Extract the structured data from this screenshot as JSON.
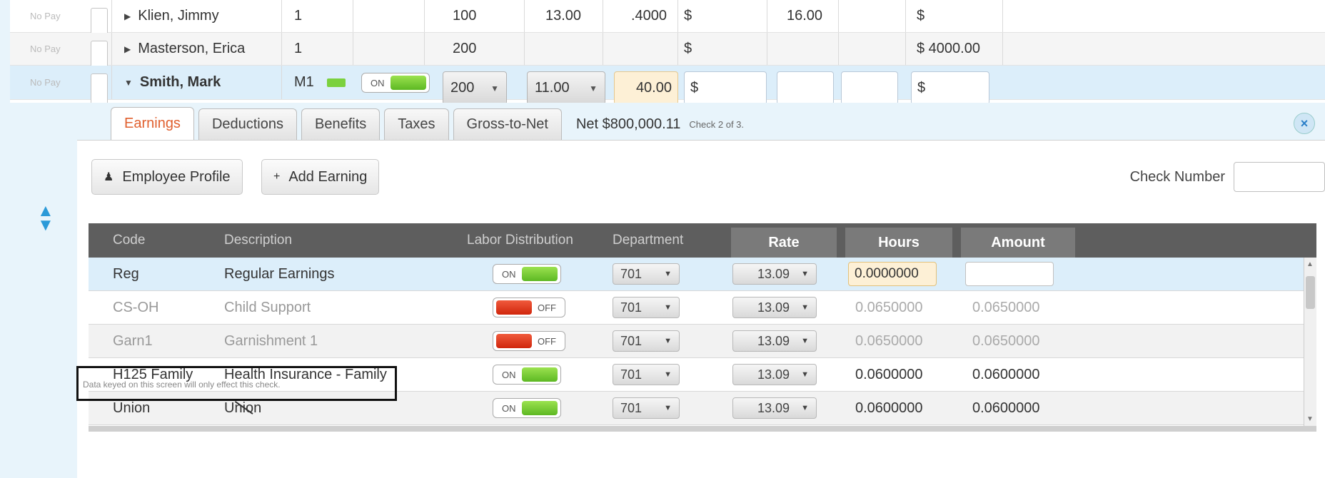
{
  "payroll_rows": [
    {
      "status": "No Pay",
      "name": "Klien, Jimmy",
      "code": "1",
      "col4": "100",
      "rate": "13.00",
      "hours": ".4000",
      "amount_prefix": "$",
      "col8": "16.00",
      "total": "$"
    },
    {
      "status": "No Pay",
      "name": "Masterson, Erica",
      "code": "1",
      "col4": "200",
      "rate": "",
      "hours": "",
      "amount_prefix": "$",
      "col8": "",
      "total": "$ 4000.00"
    },
    {
      "status": "No Pay",
      "name": "Smith, Mark",
      "code": "M1",
      "toggle": "ON",
      "col4": "200",
      "rate": "11.00",
      "hours": "40.00",
      "amount_prefix": "$",
      "total": "$"
    }
  ],
  "tabs": [
    {
      "label": "Earnings",
      "active": true
    },
    {
      "label": "Deductions"
    },
    {
      "label": "Benefits"
    },
    {
      "label": "Taxes"
    },
    {
      "label": "Gross-to-Net"
    }
  ],
  "net_label": "Net $800,000.11",
  "check_of": "Check 2 of 3.",
  "close_icon": "×",
  "buttons": {
    "employee_profile": "Employee Profile",
    "add_earning": "Add Earning"
  },
  "check_number_label": "Check Number",
  "columns": {
    "code": "Code",
    "description": "Description",
    "labor_distribution": "Labor Distribution",
    "department": "Department",
    "rate": "Rate",
    "hours": "Hours",
    "amount": "Amount"
  },
  "earnings": [
    {
      "code": "Reg",
      "description": "Regular Earnings",
      "labor": "ON",
      "department": "701",
      "rate": "13.09",
      "hours": "0.0000000",
      "amount": "",
      "dim": false
    },
    {
      "code": "CS-OH",
      "description": "Child Support",
      "labor": "OFF",
      "department": "701",
      "rate": "13.09",
      "hours": "0.0650000",
      "amount": "0.0650000",
      "dim": true
    },
    {
      "code": "Garn1",
      "description": "Garnishment 1",
      "labor": "OFF",
      "department": "701",
      "rate": "13.09",
      "hours": "0.0650000",
      "amount": "0.0650000",
      "dim": true
    },
    {
      "code": "H125 Family",
      "description": "Health Insurance - Family",
      "labor": "ON",
      "department": "701",
      "rate": "13.09",
      "hours": "0.0600000",
      "amount": "0.0600000",
      "dim": false
    },
    {
      "code": "Union",
      "description": "Union",
      "labor": "ON",
      "department": "701",
      "rate": "13.09",
      "hours": "0.0600000",
      "amount": "0.0600000",
      "dim": false
    }
  ],
  "note": "Data keyed on this screen will only effect this check.",
  "icons": {
    "profile": "user-icon",
    "add": "plus-icon",
    "dropdown": "chevron-down-icon",
    "updown": "up-down-arrows-icon"
  },
  "colors": {
    "toggle_on": "#7bd13e",
    "toggle_off": "#d0260c",
    "active_tab": "#e0602f",
    "panel_bg": "#e8f4fb"
  }
}
